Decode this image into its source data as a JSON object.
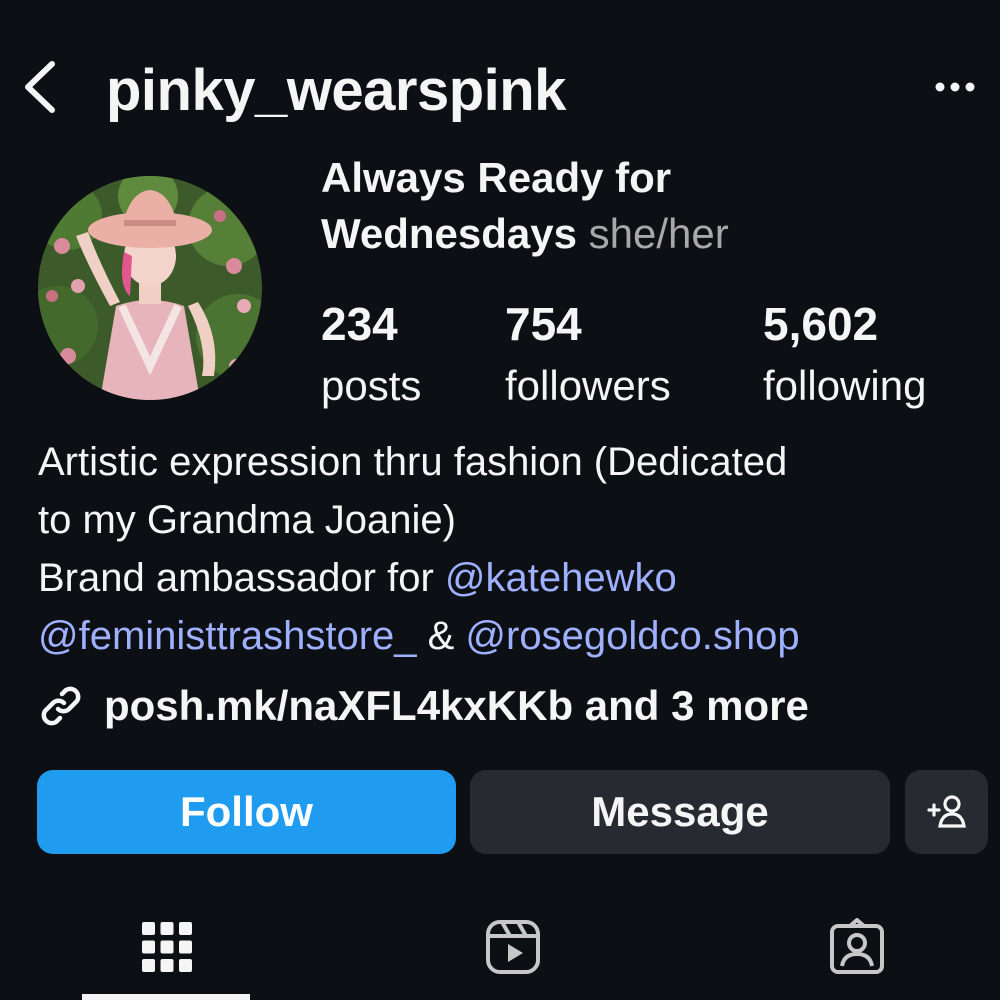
{
  "header": {
    "username": "pinky_wearspink",
    "back_icon": "chevron-left-icon",
    "more_icon": "more-horizontal-icon"
  },
  "profile": {
    "display_name": "Always Ready for Wednesdays",
    "display_name_line1": "Always Ready for",
    "display_name_line2": "Wednesdays",
    "pronouns": "she/her",
    "stats": {
      "posts": {
        "value": "234",
        "label": "posts"
      },
      "followers": {
        "value": "754",
        "label": "followers"
      },
      "following": {
        "value": "5,602",
        "label": "following"
      }
    }
  },
  "bio": {
    "line1": "Artistic expression thru fashion (Dedicated",
    "line2": "to my Grandma Joanie)",
    "line3_text": "Brand ambassador for ",
    "mention1": "@katehewko",
    "mention2": "@feministtrashstore_",
    "connector": " & ",
    "mention3": "@rosegoldco.shop"
  },
  "link": {
    "text": "posh.mk/naXFL4kxKKb and 3 more",
    "icon": "link-icon"
  },
  "actions": {
    "follow_label": "Follow",
    "message_label": "Message",
    "add_user_icon": "add-user-icon"
  },
  "tabs": [
    {
      "name": "posts-grid",
      "icon": "grid-icon",
      "active": true
    },
    {
      "name": "reels",
      "icon": "reels-icon",
      "active": false
    },
    {
      "name": "tagged",
      "icon": "tagged-user-icon",
      "active": false
    }
  ],
  "colors": {
    "background": "#0c0f14",
    "follow_button": "#1f9cf0",
    "secondary_button": "#272a30",
    "mention": "#9fb0ff",
    "muted_text": "#a8a8a8"
  }
}
